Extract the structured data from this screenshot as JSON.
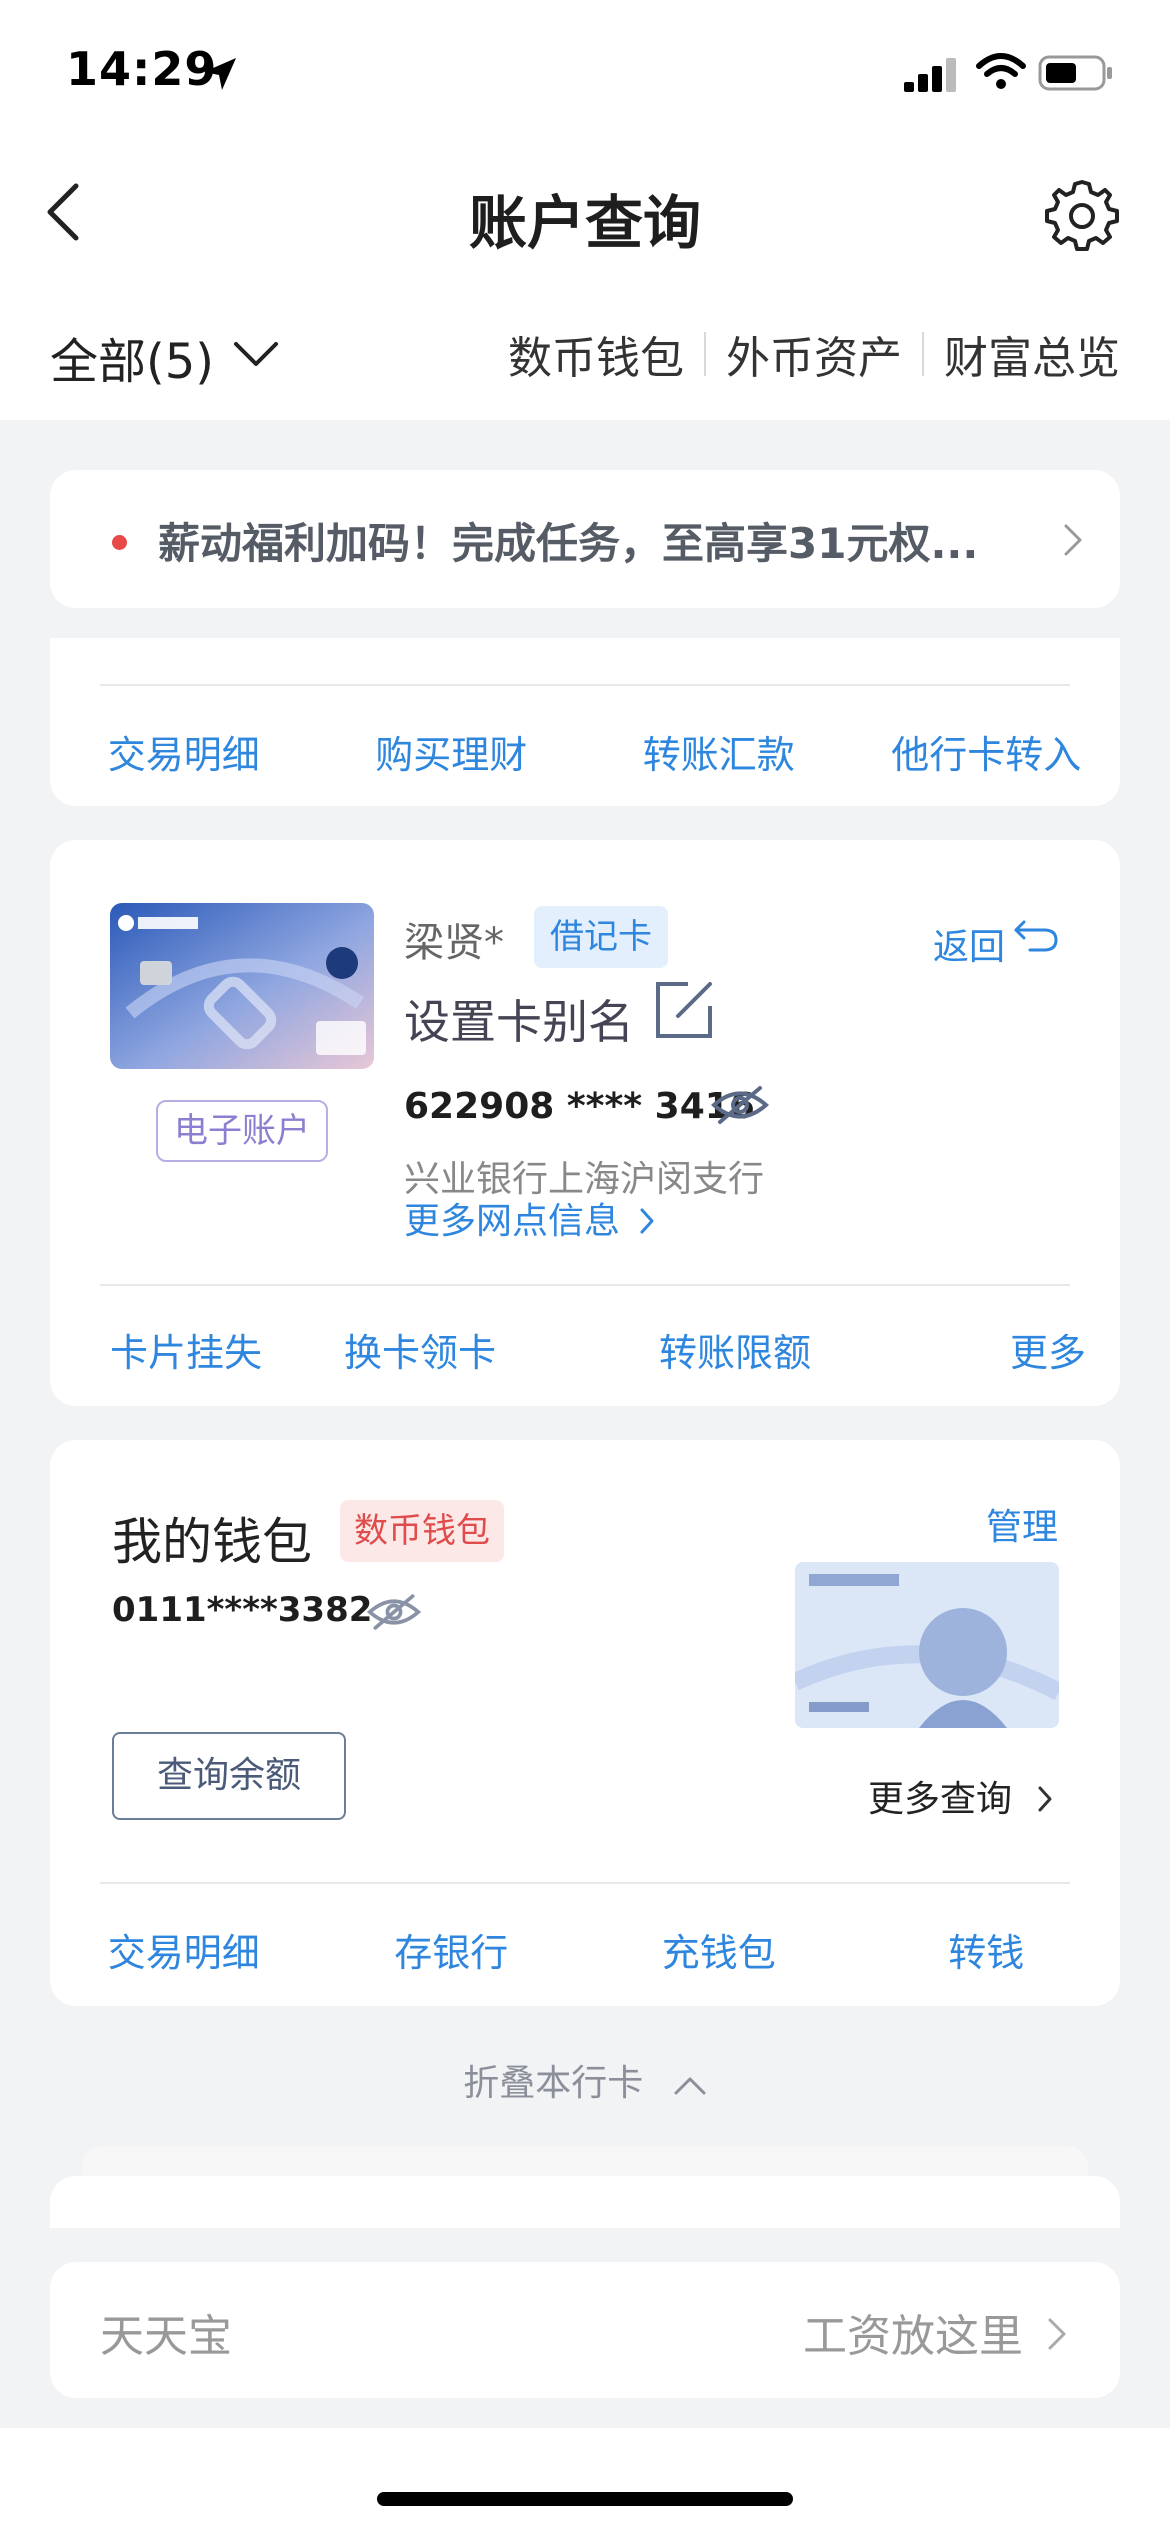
{
  "status_bar": {
    "time": "14:29"
  },
  "header": {
    "title": "账户查询"
  },
  "filter": {
    "label": "全部(5)",
    "quick_links": [
      "数币钱包",
      "外币资产",
      "财富总览"
    ]
  },
  "promo": {
    "text": "薪动福利加码！完成任务，至高享31元权..."
  },
  "card1": {
    "actions": [
      "交易明细",
      "购买理财",
      "转账汇款",
      "他行卡转入"
    ]
  },
  "debit_card": {
    "holder": "梁贤*",
    "type": "借记卡",
    "return_label": "返回",
    "alias_label": "设置卡别名",
    "number": "622908 **** 3416",
    "branch": "兴业银行上海沪闵支行",
    "more_branch": "更多网点信息",
    "e_account": "电子账户",
    "actions": [
      "卡片挂失",
      "换卡领卡",
      "转账限额",
      "更多"
    ]
  },
  "wallet": {
    "title": "我的钱包",
    "badge": "数币钱包",
    "manage": "管理",
    "number": "0111****3382",
    "query_button": "查询余额",
    "more_query": "更多查询",
    "actions": [
      "交易明细",
      "存银行",
      "充钱包",
      "转钱"
    ]
  },
  "collapse": {
    "label": "折叠本行卡"
  },
  "tiantianbao": {
    "name": "天天宝",
    "slogan": "工资放这里"
  },
  "colors": {
    "accent": "#2e86de",
    "danger": "#e84a4a",
    "background": "#f2f3f5"
  }
}
